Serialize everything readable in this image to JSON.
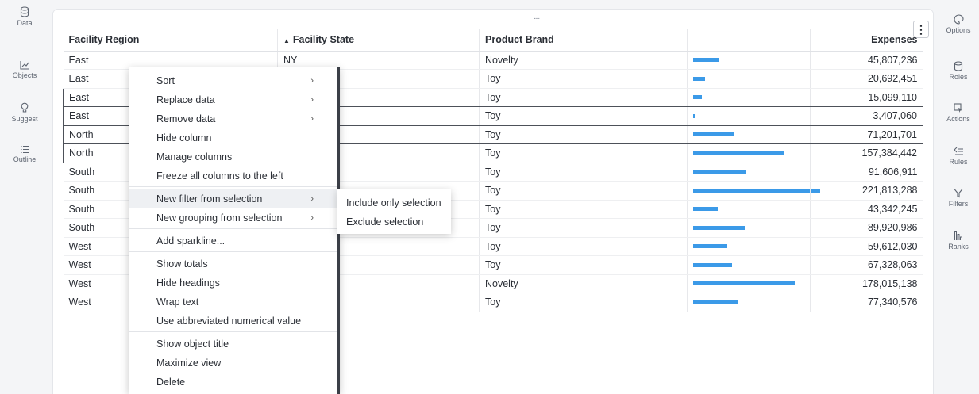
{
  "left_rail": [
    {
      "label": "Data",
      "icon": "database-icon"
    },
    {
      "label": "Objects",
      "icon": "chart-line-icon"
    },
    {
      "label": "Suggest",
      "icon": "lightbulb-icon"
    },
    {
      "label": "Outline",
      "icon": "list-icon"
    }
  ],
  "right_rail": [
    {
      "label": "Options",
      "icon": "palette-icon"
    },
    {
      "label": "Roles",
      "icon": "roles-icon"
    },
    {
      "label": "Actions",
      "icon": "cursor-click-icon"
    },
    {
      "label": "Rules",
      "icon": "rules-icon"
    },
    {
      "label": "Filters",
      "icon": "filter-icon"
    },
    {
      "label": "Ranks",
      "icon": "ranks-icon"
    }
  ],
  "table": {
    "headers": [
      "Facility Region",
      "Facility State",
      "Product Brand",
      "Expenses"
    ],
    "sort_indicator": "▲",
    "bar_color": "#3b9ae8",
    "bar_max": 221813288,
    "rows": [
      {
        "region": "East",
        "state": "NY",
        "brand": "Novelty",
        "expenses": "45,807,236",
        "value": 45807236,
        "selected": false
      },
      {
        "region": "East",
        "state": "",
        "brand": "Toy",
        "expenses": "20,692,451",
        "value": 20692451,
        "selected": false
      },
      {
        "region": "East",
        "state": "",
        "brand": "Toy",
        "expenses": "15,099,110",
        "value": 15099110,
        "selected": true
      },
      {
        "region": "East",
        "state": "",
        "brand": "Toy",
        "expenses": "3,407,060",
        "value": 3407060,
        "selected": true
      },
      {
        "region": "North",
        "state": "",
        "brand": "Toy",
        "expenses": "71,201,701",
        "value": 71201701,
        "selected": true
      },
      {
        "region": "North",
        "state": "",
        "brand": "Toy",
        "expenses": "157,384,442",
        "value": 157384442,
        "selected": true
      },
      {
        "region": "South",
        "state": "",
        "brand": "Toy",
        "expenses": "91,606,911",
        "value": 91606911,
        "selected": false
      },
      {
        "region": "South",
        "state": "",
        "brand": "Toy",
        "expenses": "221,813,288",
        "value": 221813288,
        "selected": false
      },
      {
        "region": "South",
        "state": "",
        "brand": "Toy",
        "expenses": "43,342,245",
        "value": 43342245,
        "selected": false
      },
      {
        "region": "South",
        "state": "",
        "brand": "Toy",
        "expenses": "89,920,986",
        "value": 89920986,
        "selected": false
      },
      {
        "region": "West",
        "state": "",
        "brand": "Toy",
        "expenses": "59,612,030",
        "value": 59612030,
        "selected": false
      },
      {
        "region": "West",
        "state": "",
        "brand": "Toy",
        "expenses": "67,328,063",
        "value": 67328063,
        "selected": false
      },
      {
        "region": "West",
        "state": "",
        "brand": "Novelty",
        "expenses": "178,015,138",
        "value": 178015138,
        "selected": false
      },
      {
        "region": "West",
        "state": "",
        "brand": "Toy",
        "expenses": "77,340,576",
        "value": 77340576,
        "selected": false
      }
    ]
  },
  "context_menu": {
    "groups": [
      [
        {
          "label": "Sort",
          "submenu": true
        },
        {
          "label": "Replace data",
          "submenu": true
        },
        {
          "label": "Remove data",
          "submenu": true
        },
        {
          "label": "Hide column",
          "submenu": false
        },
        {
          "label": "Manage columns",
          "submenu": false
        },
        {
          "label": "Freeze all columns to the left",
          "submenu": false
        }
      ],
      [
        {
          "label": "New filter from selection",
          "submenu": true,
          "highlighted": true
        },
        {
          "label": "New grouping from selection",
          "submenu": true
        }
      ],
      [
        {
          "label": "Add sparkline...",
          "submenu": false
        }
      ],
      [
        {
          "label": "Show totals",
          "submenu": false
        },
        {
          "label": "Hide headings",
          "submenu": false
        },
        {
          "label": "Wrap text",
          "submenu": false
        },
        {
          "label": "Use abbreviated numerical value",
          "submenu": false
        }
      ],
      [
        {
          "label": "Show object title",
          "submenu": false
        },
        {
          "label": "Maximize view",
          "submenu": false
        },
        {
          "label": "Delete",
          "submenu": false
        }
      ]
    ],
    "chevron": "›"
  },
  "submenu": {
    "items": [
      "Include only selection",
      "Exclude selection"
    ]
  },
  "kebab_symbol": "⋮",
  "drag_handle_symbol": "....",
  "accent_color": "#3b9ae8"
}
